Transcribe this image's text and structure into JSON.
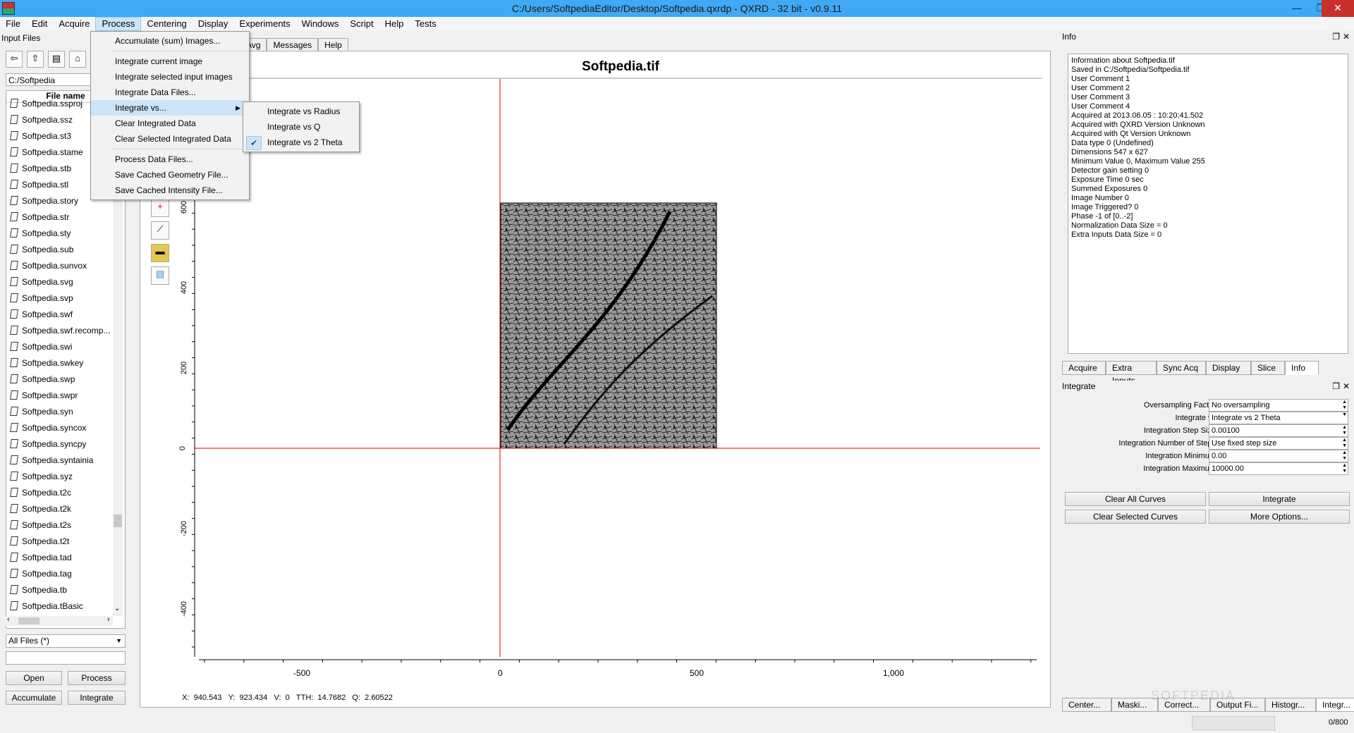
{
  "window": {
    "title": "C:/Users/SoftpediaEditor/Desktop/Softpedia.qxrdp - QXRD - 32 bit - v0.9.11"
  },
  "menubar": [
    "File",
    "Edit",
    "Acquire",
    "Process",
    "Centering",
    "Display",
    "Experiments",
    "Windows",
    "Script",
    "Help",
    "Tests"
  ],
  "process_menu": {
    "items": [
      "Accumulate (sum) Images...",
      "Integrate current image",
      "Integrate selected input images",
      "Integrate Data Files...",
      "Integrate vs...",
      "Clear Integrated Data",
      "Clear Selected Integrated Data",
      "Process Data Files...",
      "Save Cached Geometry File...",
      "Save Cached Intensity File..."
    ]
  },
  "integrate_submenu": {
    "items": [
      "Integrate vs Radius",
      "Integrate vs Q",
      "Integrate vs 2 Theta"
    ],
    "checked": "Integrate vs 2 Theta"
  },
  "left_panel": {
    "title": "Input Files",
    "path": "C:/Softpedia",
    "column_header": "File name",
    "files": [
      "Softpedia.ssproj",
      "Softpedia.ssz",
      "Softpedia.st3",
      "Softpedia.stame",
      "Softpedia.stb",
      "Softpedia.stl",
      "Softpedia.story",
      "Softpedia.str",
      "Softpedia.sty",
      "Softpedia.sub",
      "Softpedia.sunvox",
      "Softpedia.svg",
      "Softpedia.svp",
      "Softpedia.swf",
      "Softpedia.swf.recomp...",
      "Softpedia.swi",
      "Softpedia.swkey",
      "Softpedia.swp",
      "Softpedia.swpr",
      "Softpedia.syn",
      "Softpedia.syncox",
      "Softpedia.syncpy",
      "Softpedia.syntainia",
      "Softpedia.syz",
      "Softpedia.t2c",
      "Softpedia.t2k",
      "Softpedia.t2s",
      "Softpedia.t2t",
      "Softpedia.tad",
      "Softpedia.tag",
      "Softpedia.tb",
      "Softpedia.tBasic"
    ],
    "filter": "All Files (*)",
    "buttons": {
      "open": "Open",
      "process": "Process",
      "accumulate": "Accumulate",
      "integrate": "Integrate"
    }
  },
  "center": {
    "tabs": [
      "Avg",
      "Messages",
      "Help"
    ],
    "plot_title": "Softpedia.tif",
    "y_ticks": [
      "600",
      "400",
      "200",
      "0",
      "-200",
      "-400"
    ],
    "x_ticks": [
      "-500",
      "0",
      "500",
      "1,000"
    ],
    "status": {
      "x_label": "X:",
      "x": "940.543",
      "y_label": "Y:",
      "y": "923.434",
      "v_label": "V:",
      "v": "0",
      "tth_label": "TTH:",
      "tth": "14.7682",
      "q_label": "Q:",
      "q": "2.60522"
    }
  },
  "info_panel": {
    "title": "Info",
    "lines": [
      "Information about Softpedia.tif",
      "Saved in C:/Softpedia/Softpedia.tif",
      "User Comment 1",
      "User Comment 2",
      "User Comment 3",
      "User Comment 4",
      "Acquired at 2013.06.05 : 10:20:41.502",
      "Acquired with QXRD Version Unknown",
      "Acquired with Qt Version Unknown",
      "Data type 0 (Undefined)",
      "Dimensions 547 x 627",
      "Minimum Value 0, Maximum Value 255",
      "Detector gain setting 0",
      "Exposure Time 0 sec",
      "Summed Exposures 0",
      "Image Number 0",
      "Image Triggered? 0",
      "Phase -1 of [0..-2]",
      "Normalization Data Size = 0",
      "Extra Inputs Data Size = 0"
    ],
    "tabs": [
      "Acquire",
      "Extra Inputs",
      "Sync Acq",
      "Display",
      "Slice",
      "Info"
    ],
    "active_tab": "Info"
  },
  "integrate_panel": {
    "title": "Integrate",
    "fields": [
      {
        "label": "Oversampling Factor",
        "value": "No oversampling"
      },
      {
        "label": "Integrate vs",
        "value": "Integrate vs 2 Theta"
      },
      {
        "label": "Integration Step Size",
        "value": "0.00100"
      },
      {
        "label": "Integration Number of Steps",
        "value": "Use fixed step size"
      },
      {
        "label": "Integration Minimum",
        "value": "0.00"
      },
      {
        "label": "Integration Maximum",
        "value": "10000.00"
      }
    ],
    "buttons": {
      "clear_all": "Clear All Curves",
      "integrate": "Integrate",
      "clear_selected": "Clear Selected Curves",
      "more": "More Options..."
    }
  },
  "bottom_tabs": [
    "Center...",
    "Maski...",
    "Correct...",
    "Output Fi...",
    "Histogr...",
    "Integr..."
  ],
  "progress_text": "0/800",
  "watermark": "SOFTPEDIA"
}
